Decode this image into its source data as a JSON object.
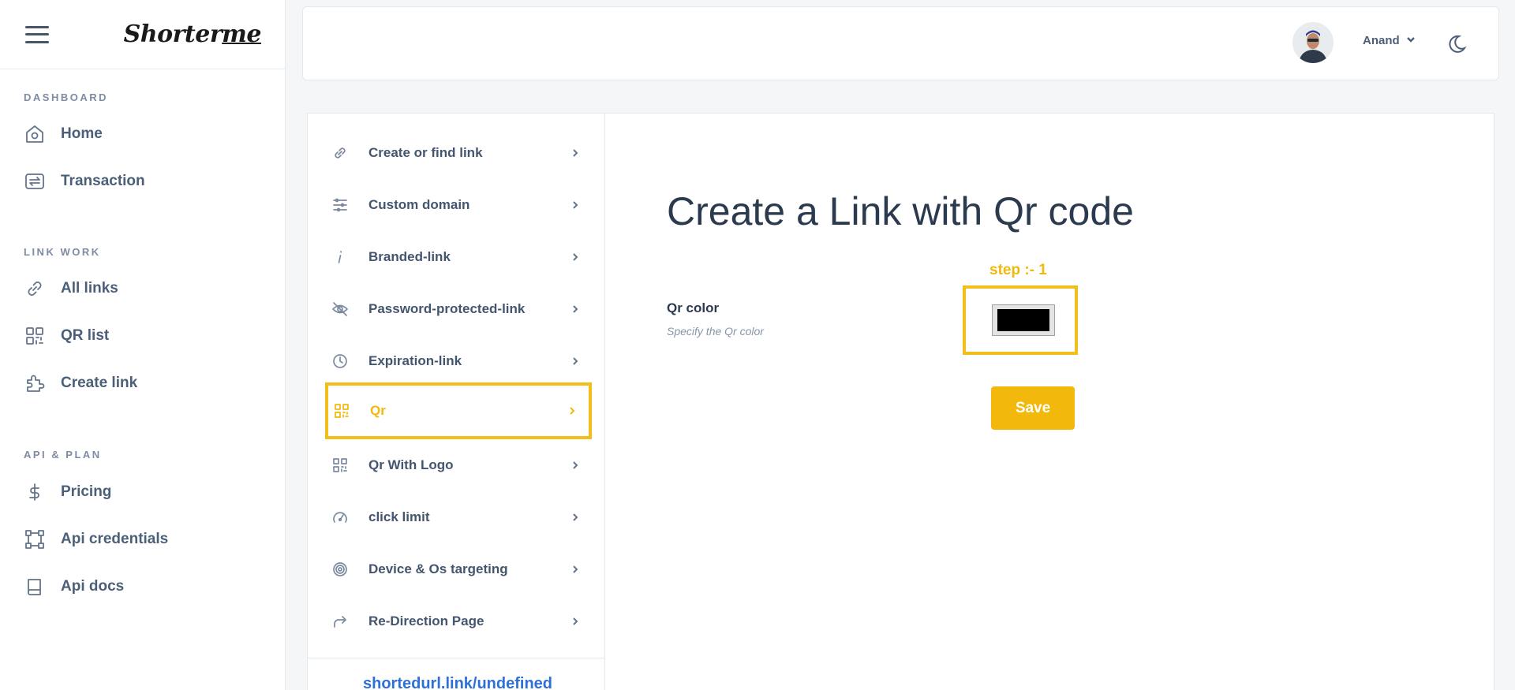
{
  "brand": {
    "logo_main": "Shorter",
    "logo_accent": "me"
  },
  "sidebar": {
    "sections": [
      {
        "title": "DASHBOARD",
        "items": [
          {
            "label": "Home",
            "icon": "home-icon"
          },
          {
            "label": "Transaction",
            "icon": "transaction-icon"
          }
        ]
      },
      {
        "title": "LINK WORK",
        "items": [
          {
            "label": "All links",
            "icon": "link-icon"
          },
          {
            "label": "QR list",
            "icon": "qr-icon"
          },
          {
            "label": "Create link",
            "icon": "puzzle-icon"
          }
        ]
      },
      {
        "title": "API & PLAN",
        "items": [
          {
            "label": "Pricing",
            "icon": "dollar-icon"
          },
          {
            "label": "Api credentials",
            "icon": "api-icon"
          },
          {
            "label": "Api docs",
            "icon": "book-icon"
          }
        ]
      }
    ]
  },
  "header": {
    "user_name": "Anand"
  },
  "menu": {
    "items": [
      {
        "label": "Create or find link",
        "icon": "link-icon"
      },
      {
        "label": "Custom domain",
        "icon": "sliders-icon"
      },
      {
        "label": "Branded-link",
        "icon": "info-icon"
      },
      {
        "label": "Password-protected-link",
        "icon": "eye-off-icon"
      },
      {
        "label": "Expiration-link",
        "icon": "clock-icon"
      },
      {
        "label": "Qr",
        "icon": "qr-icon"
      },
      {
        "label": "Qr With Logo",
        "icon": "qr-icon"
      },
      {
        "label": "click limit",
        "icon": "speedometer-icon"
      },
      {
        "label": "Device & Os targeting",
        "icon": "target-icon"
      },
      {
        "label": "Re-Direction Page",
        "icon": "redirect-icon"
      }
    ],
    "active_index": 5,
    "short_url": "shortedurl.link/undefined"
  },
  "content": {
    "title": "Create a Link with Qr code",
    "step_label": "step :- 1",
    "field_label": "Qr color",
    "field_help": "Specify the Qr color",
    "qr_color": "#000000",
    "save_label": "Save"
  },
  "colors": {
    "accent": "#f2be1a",
    "link": "#2e6fd8"
  }
}
